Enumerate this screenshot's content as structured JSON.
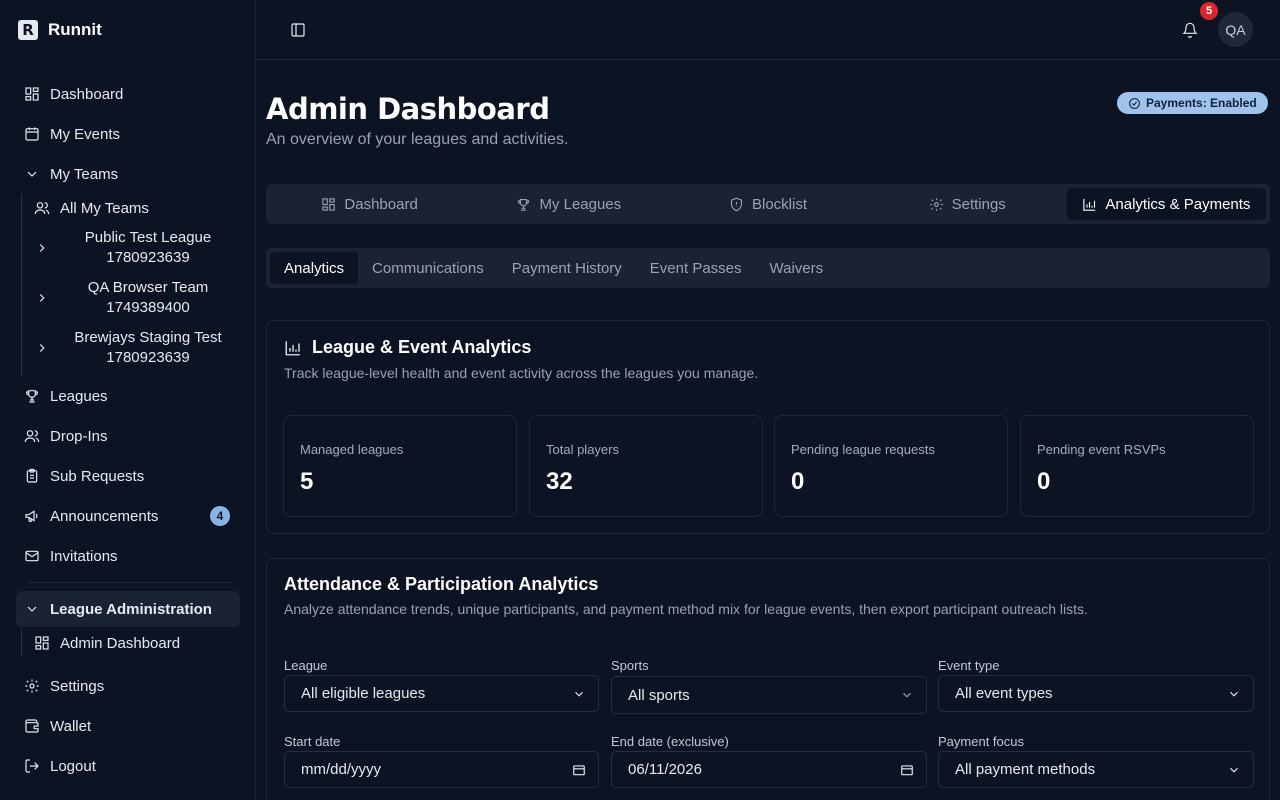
{
  "app": {
    "name": "Runnit",
    "logo_letter": "R"
  },
  "sidebar": {
    "items": [
      {
        "label": "Dashboard",
        "icon": "layout-grid-icon"
      },
      {
        "label": "My Events",
        "icon": "calendar-icon"
      },
      {
        "label": "My Teams",
        "icon": "chevron-down-icon"
      },
      {
        "label": "Leagues",
        "icon": "trophy-icon"
      },
      {
        "label": "Drop-Ins",
        "icon": "users-icon"
      },
      {
        "label": "Sub Requests",
        "icon": "clipboard-icon"
      },
      {
        "label": "Announcements",
        "icon": "megaphone-icon",
        "badge": "4"
      },
      {
        "label": "Invitations",
        "icon": "mail-icon"
      },
      {
        "label": "League Administration",
        "icon": "chevron-down-icon"
      },
      {
        "label": "Settings",
        "icon": "gear-icon"
      },
      {
        "label": "Wallet",
        "icon": "wallet-icon"
      },
      {
        "label": "Logout",
        "icon": "logout-icon"
      }
    ],
    "all_my_teams": "All My Teams",
    "teams": [
      {
        "line1": "Public Test League",
        "line2": "1780923639"
      },
      {
        "line1": "QA Browser Team",
        "line2": "1749389400"
      },
      {
        "line1": "Brewjays Staging Test",
        "line2": "1780923639"
      }
    ],
    "admin_dashboard": "Admin Dashboard"
  },
  "topbar": {
    "notification_count": "5",
    "avatar_initials": "QA"
  },
  "header": {
    "title": "Admin Dashboard",
    "subtitle": "An overview of your leagues and activities.",
    "payments_badge": "Payments: Enabled"
  },
  "tabs": [
    {
      "label": "Dashboard",
      "icon": "layout-grid-icon"
    },
    {
      "label": "My Leagues",
      "icon": "trophy-icon"
    },
    {
      "label": "Blocklist",
      "icon": "shield-icon"
    },
    {
      "label": "Settings",
      "icon": "gear-icon"
    },
    {
      "label": "Analytics & Payments",
      "icon": "bar-chart-icon",
      "active": true
    }
  ],
  "subtabs": [
    {
      "label": "Analytics",
      "active": true
    },
    {
      "label": "Communications"
    },
    {
      "label": "Payment History"
    },
    {
      "label": "Event Passes"
    },
    {
      "label": "Waivers"
    }
  ],
  "league_analytics": {
    "title": "League & Event Analytics",
    "description": "Track league-level health and event activity across the leagues you manage.",
    "stats": [
      {
        "label": "Managed leagues",
        "value": "5"
      },
      {
        "label": "Total players",
        "value": "32"
      },
      {
        "label": "Pending league requests",
        "value": "0"
      },
      {
        "label": "Pending event RSVPs",
        "value": "0"
      }
    ]
  },
  "attendance": {
    "title": "Attendance & Participation Analytics",
    "description": "Analyze attendance trends, unique participants, and payment method mix for league events, then export participant outreach lists.",
    "filters": {
      "league_label": "League",
      "league_value": "All eligible leagues",
      "sports_label": "Sports",
      "sports_value": "All sports",
      "event_type_label": "Event type",
      "event_type_value": "All event types",
      "start_date_label": "Start date",
      "start_date_value": "mm/dd/yyyy",
      "end_date_label": "End date (exclusive)",
      "end_date_value": "06/11/2026",
      "payment_focus_label": "Payment focus",
      "payment_focus_value": "All payment methods"
    }
  }
}
